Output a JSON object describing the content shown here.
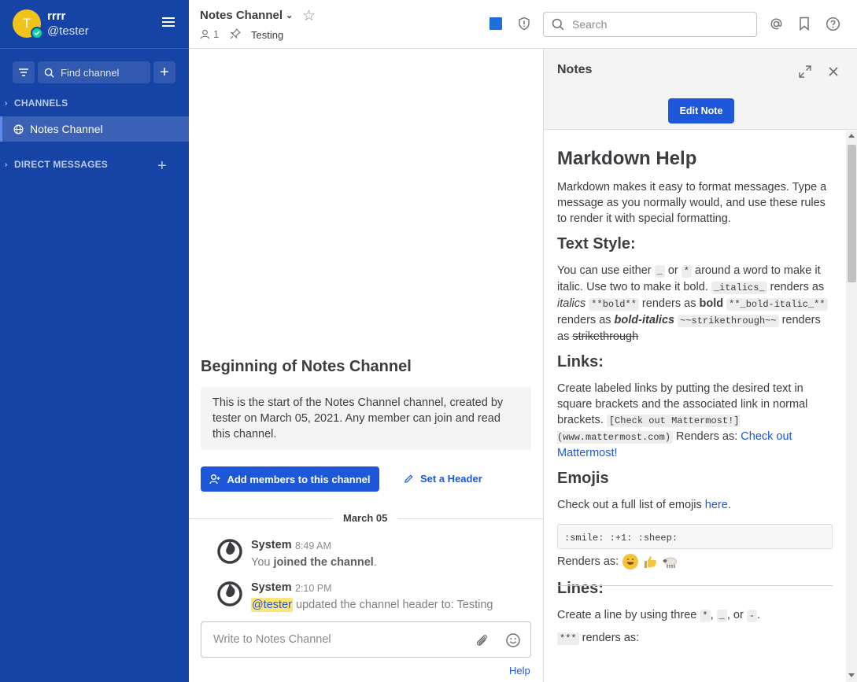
{
  "sidebar": {
    "avatar_initial": "T",
    "team_name": "rrrr",
    "username": "@tester",
    "find_channel": "Find channel",
    "channels_header": "CHANNELS",
    "channel_items": [
      {
        "label": "Notes Channel"
      }
    ],
    "dm_header": "DIRECT MESSAGES",
    "colors": {
      "background": "#1543a6",
      "status": "#06d6a0",
      "avatar": "#f0c419"
    }
  },
  "header": {
    "channel_name": "Notes Channel",
    "member_count": "1",
    "channel_header": "Testing",
    "search_placeholder": "Search"
  },
  "center": {
    "intro_title": "Beginning of Notes Channel",
    "intro_text": "This is the start of the Notes Channel channel, created by tester on March 05, 2021. Any member can join and read this channel.",
    "add_members_label": "Add members to this channel",
    "set_header_label": "Set a Header",
    "date_separator": "March 05",
    "posts": [
      {
        "author": "System",
        "time": "8:49 AM",
        "pre": "You ",
        "bold": "joined the channel",
        "post": "."
      },
      {
        "author": "System",
        "time": "2:10 PM",
        "mention": "@tester",
        "post": " updated the channel header to: Testing"
      }
    ],
    "composer_placeholder": "Write to Notes Channel",
    "help_link": "Help"
  },
  "rhs": {
    "title": "Notes",
    "edit_button": "Edit Note",
    "content": {
      "h_markdown": "Markdown Help",
      "p_markdown": "Markdown makes it easy to format messages. Type a message as you normally would, and use these rules to render it with special formatting.",
      "h_textstyle": "Text Style:",
      "ts_1": "You can use either ",
      "ts_code1": "_",
      "ts_2": " or ",
      "ts_code2": "*",
      "ts_3": " around a word to make it italic. Use two to make it bold. ",
      "ts_code3": "_italics_",
      "ts_4": " renders as ",
      "ts_italics": "italics",
      "ts_5": " ",
      "ts_code4": "**bold**",
      "ts_6": " renders as ",
      "ts_bold": "bold",
      "ts_7": " ",
      "ts_code5": "**_bold-italic_**",
      "ts_8": " renders as ",
      "ts_bolditalic": "bold-italics",
      "ts_9": " ",
      "ts_code6": "~~strikethrough~~",
      "ts_10": " renders as ",
      "ts_strike": "strikethrough",
      "h_links": "Links:",
      "lk_1": "Create labeled links by putting the desired text in square brackets and the associated link in normal brackets. ",
      "lk_code": "[Check out Mattermost!](www.mattermost.com)",
      "lk_2": " Renders as: ",
      "lk_link": "Check out Mattermost!",
      "h_emojis": "Emojis",
      "em_1": "Check out a full list of emojis ",
      "em_link": "here",
      "em_2": ".",
      "em_code": ":smile: :+1: :sheep:",
      "em_renders": "Renders as:",
      "h_lines": "Lines:",
      "ln_1": "Create a line by using three ",
      "ln_c1": "*",
      "ln_2": ", ",
      "ln_c2": "_",
      "ln_3": ", or ",
      "ln_c3": "-",
      "ln_4": ".",
      "ln_code": "***",
      "ln_5": " renders as:"
    }
  }
}
